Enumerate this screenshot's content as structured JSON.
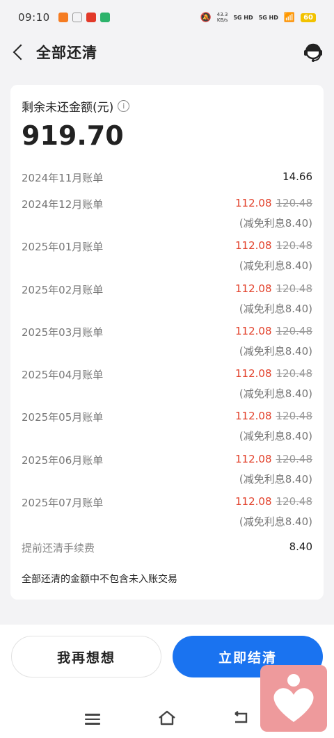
{
  "status": {
    "time": "09:10",
    "net_speed": "43.3",
    "net_unit": "KB/s",
    "sig1": "5G HD",
    "sig2": "5G HD",
    "battery": "60"
  },
  "header": {
    "title": "全部还清"
  },
  "summary": {
    "label": "剩余未还金额(元)",
    "info_icon": "i",
    "amount": "919.70"
  },
  "first_bill": {
    "label": "2024年11月账单",
    "value": "14.66"
  },
  "bills": [
    {
      "label": "2024年12月账单",
      "new": "112.08",
      "old": "120.48",
      "discount": "(减免利息8.40)"
    },
    {
      "label": "2025年01月账单",
      "new": "112.08",
      "old": "120.48",
      "discount": "(减免利息8.40)"
    },
    {
      "label": "2025年02月账单",
      "new": "112.08",
      "old": "120.48",
      "discount": "(减免利息8.40)"
    },
    {
      "label": "2025年03月账单",
      "new": "112.08",
      "old": "120.48",
      "discount": "(减免利息8.40)"
    },
    {
      "label": "2025年04月账单",
      "new": "112.08",
      "old": "120.48",
      "discount": "(减免利息8.40)"
    },
    {
      "label": "2025年05月账单",
      "new": "112.08",
      "old": "120.48",
      "discount": "(减免利息8.40)"
    },
    {
      "label": "2025年06月账单",
      "new": "112.08",
      "old": "120.48",
      "discount": "(减免利息8.40)"
    },
    {
      "label": "2025年07月账单",
      "new": "112.08",
      "old": "120.48",
      "discount": "(减免利息8.40)"
    }
  ],
  "fee": {
    "label": "提前还清手续费",
    "value": "8.40"
  },
  "note": "全部还清的金额中不包含未入账交易",
  "buttons": {
    "think": "我再想想",
    "settle": "立即结清"
  },
  "colors": {
    "accent": "#1a73f0",
    "discount_red": "#e2422c",
    "badge": "#ee9a9c"
  }
}
